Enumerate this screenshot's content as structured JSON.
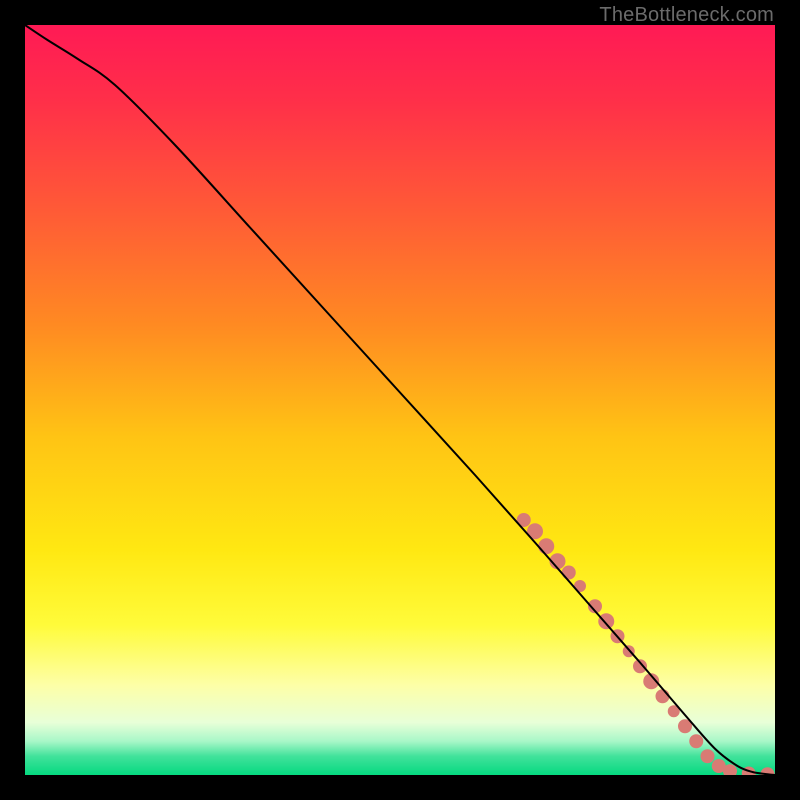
{
  "watermark": "TheBottleneck.com",
  "chart_data": {
    "type": "line",
    "title": "",
    "xlabel": "",
    "ylabel": "",
    "xlim": [
      0,
      100
    ],
    "ylim": [
      0,
      100
    ],
    "grid": false,
    "legend": false,
    "background_gradient_stops": [
      {
        "pos": 0.0,
        "color": "#ff1a55"
      },
      {
        "pos": 0.1,
        "color": "#ff2f49"
      },
      {
        "pos": 0.25,
        "color": "#ff5b36"
      },
      {
        "pos": 0.4,
        "color": "#ff8a22"
      },
      {
        "pos": 0.55,
        "color": "#ffc414"
      },
      {
        "pos": 0.7,
        "color": "#ffe812"
      },
      {
        "pos": 0.8,
        "color": "#fffb3a"
      },
      {
        "pos": 0.88,
        "color": "#fdffa7"
      },
      {
        "pos": 0.93,
        "color": "#e8ffd8"
      },
      {
        "pos": 0.955,
        "color": "#a8f7c8"
      },
      {
        "pos": 0.975,
        "color": "#41e29b"
      },
      {
        "pos": 1.0,
        "color": "#05d980"
      }
    ],
    "series": [
      {
        "name": "curve",
        "stroke": "#000000",
        "x": [
          0,
          3,
          7,
          12,
          20,
          30,
          40,
          50,
          60,
          68,
          75,
          82,
          88,
          92,
          95,
          97,
          99,
          100
        ],
        "y": [
          100,
          98,
          95.5,
          92,
          84,
          73,
          62,
          51,
          40,
          31,
          23,
          15,
          8,
          3.5,
          1.2,
          0.4,
          0.1,
          0
        ]
      }
    ],
    "markers": [
      {
        "shape": "circle",
        "color": "#d97b74",
        "r": 7,
        "x": 66.5,
        "y": 34.0
      },
      {
        "shape": "circle",
        "color": "#d97b74",
        "r": 8,
        "x": 68.0,
        "y": 32.5
      },
      {
        "shape": "circle",
        "color": "#d97b74",
        "r": 8,
        "x": 69.5,
        "y": 30.5
      },
      {
        "shape": "circle",
        "color": "#d97b74",
        "r": 8,
        "x": 71.0,
        "y": 28.5
      },
      {
        "shape": "circle",
        "color": "#d97b74",
        "r": 7,
        "x": 72.5,
        "y": 27.0
      },
      {
        "shape": "circle",
        "color": "#d97b74",
        "r": 6,
        "x": 74.0,
        "y": 25.2
      },
      {
        "shape": "circle",
        "color": "#d97b74",
        "r": 7,
        "x": 76.0,
        "y": 22.5
      },
      {
        "shape": "circle",
        "color": "#d97b74",
        "r": 8,
        "x": 77.5,
        "y": 20.5
      },
      {
        "shape": "circle",
        "color": "#d97b74",
        "r": 7,
        "x": 79.0,
        "y": 18.5
      },
      {
        "shape": "circle",
        "color": "#d97b74",
        "r": 6,
        "x": 80.5,
        "y": 16.5
      },
      {
        "shape": "circle",
        "color": "#d97b74",
        "r": 7,
        "x": 82.0,
        "y": 14.5
      },
      {
        "shape": "circle",
        "color": "#d97b74",
        "r": 8,
        "x": 83.5,
        "y": 12.5
      },
      {
        "shape": "circle",
        "color": "#d97b74",
        "r": 7,
        "x": 85.0,
        "y": 10.5
      },
      {
        "shape": "circle",
        "color": "#d97b74",
        "r": 6,
        "x": 86.5,
        "y": 8.5
      },
      {
        "shape": "circle",
        "color": "#d97b74",
        "r": 7,
        "x": 88.0,
        "y": 6.5
      },
      {
        "shape": "circle",
        "color": "#d97b74",
        "r": 7,
        "x": 89.5,
        "y": 4.5
      },
      {
        "shape": "circle",
        "color": "#d97b74",
        "r": 7,
        "x": 91.0,
        "y": 2.5
      },
      {
        "shape": "circle",
        "color": "#d97b74",
        "r": 7,
        "x": 92.5,
        "y": 1.2
      },
      {
        "shape": "circle",
        "color": "#d97b74",
        "r": 7,
        "x": 94.0,
        "y": 0.5
      },
      {
        "shape": "circle",
        "color": "#d97b74",
        "r": 7,
        "x": 96.5,
        "y": 0.2
      },
      {
        "shape": "circle",
        "color": "#d97b74",
        "r": 7,
        "x": 99.0,
        "y": 0.1
      }
    ]
  }
}
